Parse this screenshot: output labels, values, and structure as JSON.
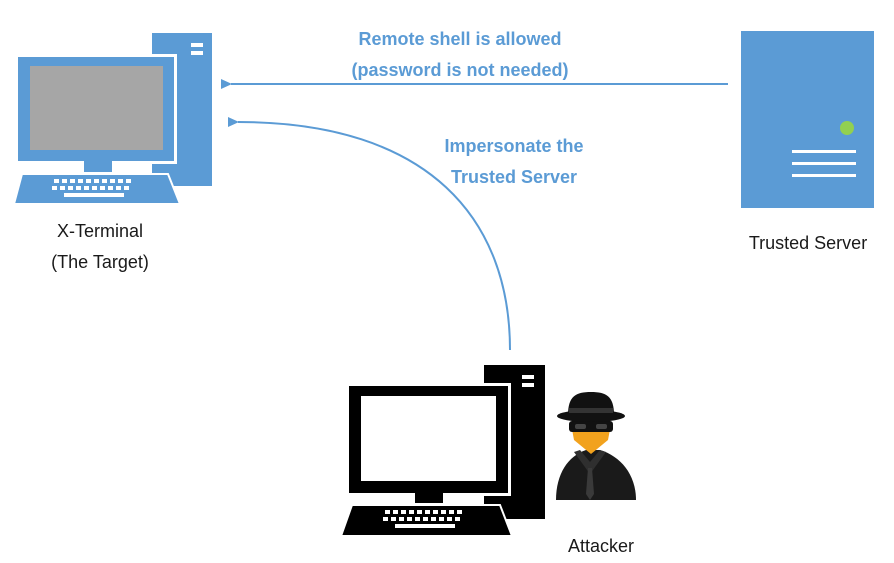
{
  "colors": {
    "blue": "#5b9bd5",
    "blue_text": "#5b9bd5",
    "monitor_screen": "#a6a6a6",
    "black": "#000000",
    "attacker_skin": "#f2a21d"
  },
  "nodes": {
    "x_terminal": {
      "icon": "desktop-computer-icon",
      "label_line1": "X-Terminal",
      "label_line2": "(The Target)"
    },
    "trusted_server": {
      "icon": "server-tower-icon",
      "label": "Trusted Server"
    },
    "attacker_pc": {
      "icon": "desktop-computer-icon"
    },
    "attacker_person": {
      "icon": "spy-hacker-icon",
      "label": "Attacker"
    }
  },
  "edges": {
    "trust": {
      "from": "Trusted Server",
      "to": "X-Terminal",
      "label_line1": "Remote shell is allowed",
      "label_line2": "(password is not needed)"
    },
    "impersonation": {
      "from": "Attacker",
      "to": "X-Terminal",
      "label_line1": "Impersonate the",
      "label_line2": "Trusted Server"
    }
  }
}
